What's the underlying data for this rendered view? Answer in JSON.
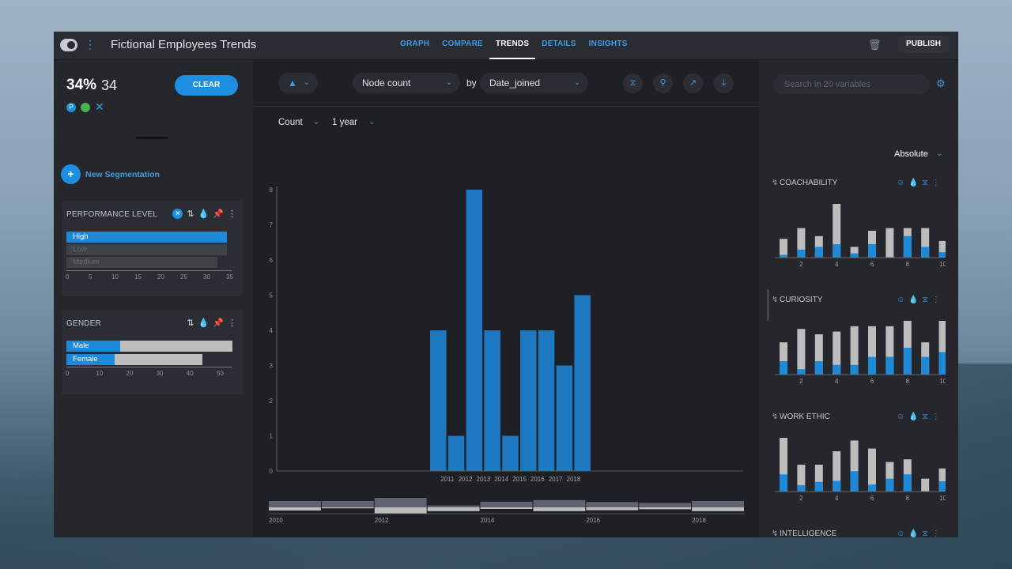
{
  "header": {
    "title": "Fictional Employees Trends",
    "tabs": [
      {
        "label": "GRAPH",
        "active": false
      },
      {
        "label": "COMPARE",
        "active": false
      },
      {
        "label": "TRENDS",
        "active": true
      },
      {
        "label": "DETAILS",
        "active": false
      },
      {
        "label": "INSIGHTS",
        "active": false
      }
    ],
    "publish_label": "PUBLISH"
  },
  "selection": {
    "percent": "34%",
    "count": "34",
    "clear_label": "CLEAR",
    "new_segmentation_label": "New Segmentation"
  },
  "filters": {
    "performance": {
      "title": "PERFORMANCE LEVEL",
      "rows": [
        {
          "label": "High",
          "value": 34,
          "selected": true
        },
        {
          "label": "Low",
          "value": 34,
          "selected": false
        },
        {
          "label": "Medium",
          "value": 32,
          "selected": false
        }
      ],
      "ticks": [
        "0",
        "5",
        "10",
        "15",
        "20",
        "25",
        "30",
        "35"
      ]
    },
    "gender": {
      "title": "GENDER",
      "rows": [
        {
          "label": "Male",
          "selected_value": 17,
          "total_value": 54
        },
        {
          "label": "Female",
          "selected_value": 15,
          "total_value": 45
        }
      ],
      "ticks": [
        "0",
        "10",
        "20",
        "30",
        "40",
        "50"
      ]
    }
  },
  "toolbar": {
    "metric": "Node count",
    "by_label": "by",
    "group_by": "Date_joined",
    "count_label": "Count",
    "interval_label": "1 year"
  },
  "chart_data": {
    "type": "bar",
    "categories": [
      "2011",
      "2012",
      "2013",
      "2014",
      "2015",
      "2016",
      "2017",
      "2018"
    ],
    "bars_x": [
      2011,
      2011.5,
      2012,
      2012.5,
      2013,
      2013.5,
      2014,
      2014.5,
      2015,
      2015.5,
      2016,
      2016.5,
      2017,
      2017.5,
      2018
    ],
    "values": [
      4,
      1,
      8,
      4,
      1,
      4,
      4,
      3,
      5
    ],
    "y_ticks": [
      "0",
      "1",
      "2",
      "3",
      "4",
      "5",
      "6",
      "7",
      "8"
    ],
    "ylim": [
      0,
      8
    ],
    "color": "#1f78c2"
  },
  "timeline": {
    "labels": [
      "2010",
      "2012",
      "2014",
      "2016",
      "2018"
    ],
    "values": [
      [
        2,
        1
      ],
      [
        2,
        0.3
      ],
      [
        3,
        2
      ],
      [
        0.6,
        1.2
      ],
      [
        1.8,
        0.5
      ],
      [
        2.3,
        1.2
      ],
      [
        1.7,
        0.9
      ],
      [
        1.4,
        0.6
      ],
      [
        2,
        1.2
      ]
    ]
  },
  "variables": {
    "search_placeholder": "Search in 20 variables",
    "mode_label": "Absolute",
    "x_ticks": [
      "2",
      "4",
      "6",
      "8",
      "10"
    ],
    "list": [
      {
        "title": "COACHABILITY",
        "totals": [
          3.5,
          5.5,
          4,
          10,
          2,
          5,
          5.5,
          5.5,
          5.5,
          3.1
        ],
        "selected": [
          0.5,
          1.5,
          2,
          2.5,
          0.8,
          2.5,
          0,
          4,
          2,
          1
        ]
      },
      {
        "title": "CURIOSITY",
        "totals": [
          6,
          8.5,
          7.5,
          8,
          9,
          9,
          9,
          10,
          6,
          10
        ],
        "selected": [
          2.5,
          1,
          2.5,
          1.8,
          1.8,
          3.3,
          3.3,
          5,
          3.3,
          4.2
        ]
      },
      {
        "title": "WORK ETHIC",
        "totals": [
          10,
          5,
          5,
          7.5,
          9.5,
          8,
          5.5,
          6,
          2.4,
          4.3
        ],
        "selected": [
          3.2,
          1.2,
          1.8,
          2,
          3.8,
          1.3,
          2.4,
          3.2,
          0,
          1.9
        ]
      },
      {
        "title": "INTELLIGENCE",
        "totals": [],
        "selected": []
      }
    ]
  },
  "colors": {
    "accent": "#1e8fe0",
    "selected_bar": "#1e88d9",
    "unselected_bar": "#bdbdbd"
  }
}
